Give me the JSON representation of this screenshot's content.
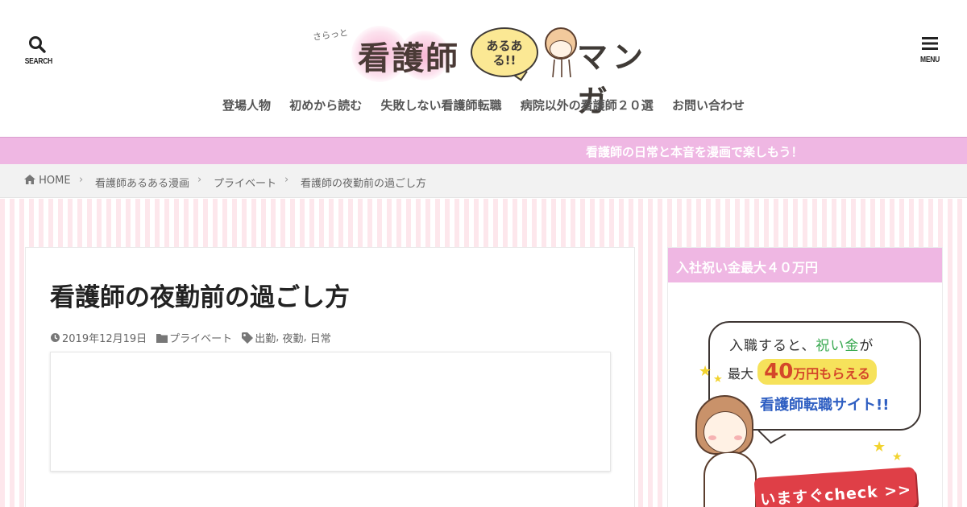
{
  "header": {
    "search_label": "SEARCH",
    "menu_label": "MENU",
    "logo": {
      "small_text": "さらっと",
      "main_text": "看護師",
      "bubble_text_line1": "あるあ",
      "bubble_text_line2": "る!!",
      "manga_text": "マンガ"
    }
  },
  "nav": {
    "items": [
      {
        "label": "登場人物"
      },
      {
        "label": "初めから読む"
      },
      {
        "label": "失敗しない看護師転職"
      },
      {
        "label": "病院以外の看護師２０選"
      },
      {
        "label": "お問い合わせ"
      }
    ]
  },
  "banner": {
    "text": "看護師の日常と本音を漫画で楽しもう！"
  },
  "breadcrumb": {
    "home": "HOME",
    "items": [
      "看護師あるある漫画",
      "プライベート",
      "看護師の夜勤前の過ごし方"
    ]
  },
  "article": {
    "title": "看護師の夜勤前の過ごし方",
    "date": "2019年12月19日",
    "category": "プライベート",
    "tags": [
      "出勤",
      "夜勤",
      "日常"
    ]
  },
  "sidebar": {
    "widget_title": "入社祝い金最大４０万円",
    "ad": {
      "line1_a": "入職すると、",
      "line1_b": "祝い金",
      "line1_c": "が",
      "line2_a": "最大",
      "line2_amount": "40",
      "line2_unit": "万円",
      "line2_b": "もらえる",
      "line3": "看護師転職サイト!!",
      "cta": "いますぐcheck >>"
    }
  },
  "colors": {
    "accent_pink": "#efb7e3",
    "stripe_pink": "#fde7ec",
    "cta_red": "#df3f47"
  }
}
